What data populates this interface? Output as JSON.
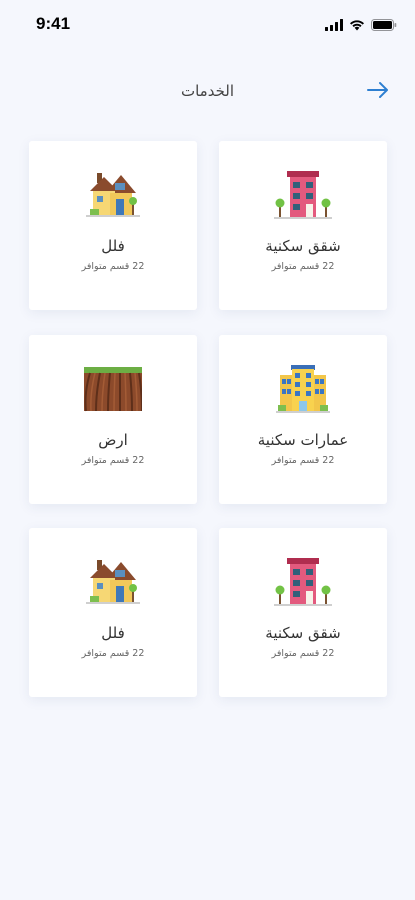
{
  "status_bar": {
    "time": "9:41",
    "signal_icon": "cellular-signal-icon",
    "wifi_icon": "wifi-icon",
    "battery_icon": "battery-icon"
  },
  "header": {
    "title": "الخدمات",
    "back_icon": "arrow-right-icon",
    "accent_color": "#2d7fd1"
  },
  "cards": [
    {
      "title": "شقق سكنية",
      "subtitle": "22 قسم متوافر",
      "icon": "apartment-building-icon"
    },
    {
      "title": "فلل",
      "subtitle": "22 قسم متوافر",
      "icon": "villa-house-icon"
    },
    {
      "title": "عمارات سكنية",
      "subtitle": "22 قسم متوافر",
      "icon": "residential-tower-icon"
    },
    {
      "title": "ارض",
      "subtitle": "22 قسم متوافر",
      "icon": "farmland-icon"
    },
    {
      "title": "شقق سكنية",
      "subtitle": "22 قسم متوافر",
      "icon": "apartment-building-icon"
    },
    {
      "title": "فلل",
      "subtitle": "22 قسم متوافر",
      "icon": "villa-house-icon"
    }
  ]
}
